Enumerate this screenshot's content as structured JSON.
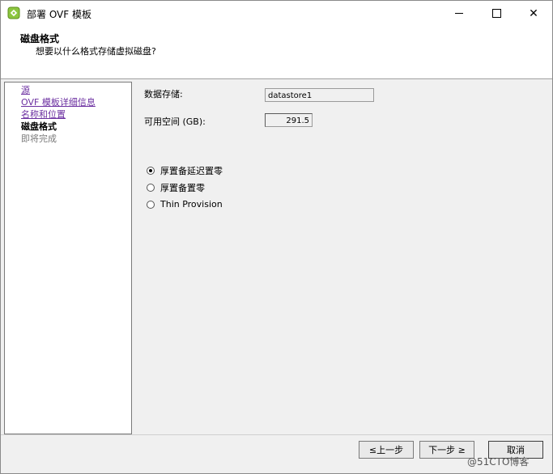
{
  "window": {
    "title": "部署 OVF 模板",
    "icon": "ovf-deploy-icon",
    "controls": {
      "minimize": "minimize-icon",
      "maximize": "maximize-icon",
      "close": "✕"
    }
  },
  "header": {
    "title": "磁盘格式",
    "subtitle": "想要以什么格式存储虚拟磁盘?"
  },
  "steps": [
    {
      "label": "源",
      "state": "link"
    },
    {
      "label": "OVF 模板详细信息",
      "state": "link"
    },
    {
      "label": "名称和位置",
      "state": "link"
    },
    {
      "label": "磁盘格式",
      "state": "current"
    },
    {
      "label": "即将完成",
      "state": "future"
    }
  ],
  "content": {
    "datastore_label": "数据存储:",
    "datastore_value": "datastore1",
    "space_label": "可用空间 (GB):",
    "space_value": "291.5",
    "options": [
      {
        "label": "厚置备延迟置零",
        "checked": true
      },
      {
        "label": "厚置备置零",
        "checked": false
      },
      {
        "label": "Thin Provision",
        "checked": false
      }
    ]
  },
  "buttons": {
    "back": "≤上一步",
    "next": "下一步 ≥",
    "cancel": "取消"
  },
  "watermark": "@51CTO博客"
}
